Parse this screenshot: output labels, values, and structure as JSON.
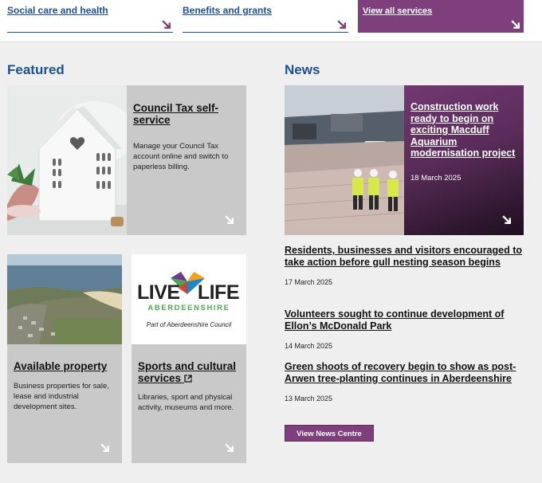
{
  "services": {
    "items": [
      {
        "label": "Social care and health"
      },
      {
        "label": "Benefits and grants"
      }
    ],
    "view_all": "View all services"
  },
  "featured": {
    "heading": "Featured",
    "council_tax": {
      "title": "Council Tax self-service",
      "description": "Manage your Council Tax account online and switch to paperless billing."
    },
    "property": {
      "title": "Available property",
      "description": "Business properties for sale, lease and industrial development sites."
    },
    "sports": {
      "title": "Sports and cultural services",
      "description": "Libraries, sport and physical activity, museums and more.",
      "logo_text_left": "LIVE",
      "logo_text_right": "LIFE",
      "logo_region": "ABERDEENSHIRE",
      "logo_caption": "Part of Aberdeenshire Council"
    }
  },
  "news": {
    "heading": "News",
    "feature": {
      "title": "Construction work ready to begin on exciting Macduff Aquarium modernisation project",
      "date": "18 March 2025"
    },
    "items": [
      {
        "title": "Residents, businesses and visitors encouraged to take action before gull nesting season begins",
        "date": "17 March 2025"
      },
      {
        "title": "Volunteers sought to continue development of Ellon’s McDonald Park",
        "date": "14 March 2025"
      },
      {
        "title": "Green shoots of recovery begin to show as post-Arwen tree-planting continues in Aberdeenshire",
        "date": "13 March 2025"
      }
    ],
    "button": "View News Centre"
  },
  "colors": {
    "brand_blue": "#1d4f91",
    "accent_purple": "#7e3f7c",
    "tile_grey": "#c9c9c9"
  }
}
